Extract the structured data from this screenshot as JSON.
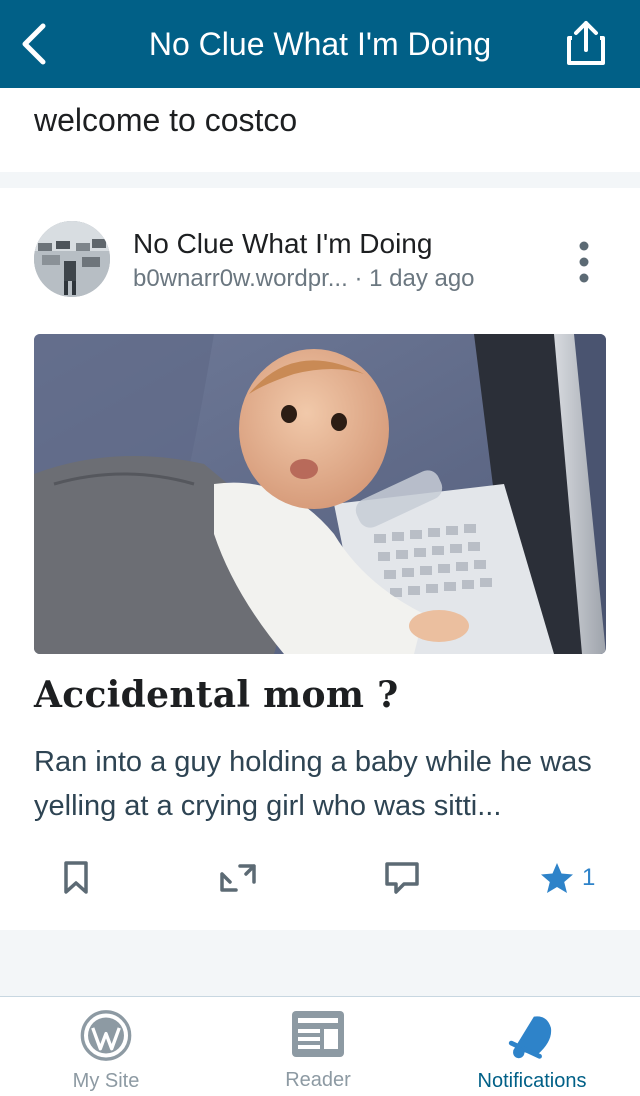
{
  "header": {
    "title": "No Clue What I'm Doing",
    "back_icon": "chevron-left-icon",
    "share_icon": "share-icon"
  },
  "excerpt": {
    "text": "welcome to costco"
  },
  "post": {
    "site_name": "No Clue What I'm Doing",
    "site_url": "b0wnarr0w.wordpr...",
    "time_sep": " · ",
    "time": "1 day ago",
    "title": "Accidental mom ?",
    "excerpt": "Ran into a guy holding a baby while he was yelling at a crying girl who was sitti...",
    "like_count": "1"
  },
  "colors": {
    "header_bg": "#016087",
    "accent": "#2e83c9",
    "text": "#1d1f21"
  },
  "tabs": [
    {
      "label": "My Site",
      "icon": "wordpress-icon",
      "active": false
    },
    {
      "label": "Reader",
      "icon": "reader-icon",
      "active": false
    },
    {
      "label": "Notifications",
      "icon": "bell-icon",
      "active": true
    }
  ]
}
